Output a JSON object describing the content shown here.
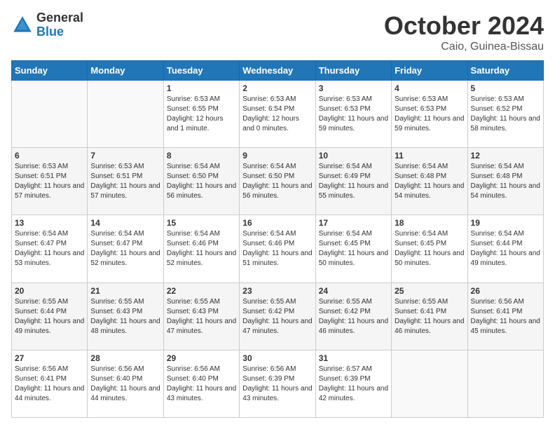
{
  "logo": {
    "general": "General",
    "blue": "Blue"
  },
  "title": {
    "month": "October 2024",
    "location": "Caio, Guinea-Bissau"
  },
  "weekdays": [
    "Sunday",
    "Monday",
    "Tuesday",
    "Wednesday",
    "Thursday",
    "Friday",
    "Saturday"
  ],
  "weeks": [
    [
      {
        "day": null
      },
      {
        "day": null
      },
      {
        "day": "1",
        "sunrise": "6:53 AM",
        "sunset": "6:55 PM",
        "daylight": "12 hours and 1 minute."
      },
      {
        "day": "2",
        "sunrise": "6:53 AM",
        "sunset": "6:54 PM",
        "daylight": "12 hours and 0 minutes."
      },
      {
        "day": "3",
        "sunrise": "6:53 AM",
        "sunset": "6:53 PM",
        "daylight": "11 hours and 59 minutes."
      },
      {
        "day": "4",
        "sunrise": "6:53 AM",
        "sunset": "6:53 PM",
        "daylight": "11 hours and 59 minutes."
      },
      {
        "day": "5",
        "sunrise": "6:53 AM",
        "sunset": "6:52 PM",
        "daylight": "11 hours and 58 minutes."
      }
    ],
    [
      {
        "day": "6",
        "sunrise": "6:53 AM",
        "sunset": "6:51 PM",
        "daylight": "11 hours and 57 minutes."
      },
      {
        "day": "7",
        "sunrise": "6:53 AM",
        "sunset": "6:51 PM",
        "daylight": "11 hours and 57 minutes."
      },
      {
        "day": "8",
        "sunrise": "6:54 AM",
        "sunset": "6:50 PM",
        "daylight": "11 hours and 56 minutes."
      },
      {
        "day": "9",
        "sunrise": "6:54 AM",
        "sunset": "6:50 PM",
        "daylight": "11 hours and 56 minutes."
      },
      {
        "day": "10",
        "sunrise": "6:54 AM",
        "sunset": "6:49 PM",
        "daylight": "11 hours and 55 minutes."
      },
      {
        "day": "11",
        "sunrise": "6:54 AM",
        "sunset": "6:48 PM",
        "daylight": "11 hours and 54 minutes."
      },
      {
        "day": "12",
        "sunrise": "6:54 AM",
        "sunset": "6:48 PM",
        "daylight": "11 hours and 54 minutes."
      }
    ],
    [
      {
        "day": "13",
        "sunrise": "6:54 AM",
        "sunset": "6:47 PM",
        "daylight": "11 hours and 53 minutes."
      },
      {
        "day": "14",
        "sunrise": "6:54 AM",
        "sunset": "6:47 PM",
        "daylight": "11 hours and 52 minutes."
      },
      {
        "day": "15",
        "sunrise": "6:54 AM",
        "sunset": "6:46 PM",
        "daylight": "11 hours and 52 minutes."
      },
      {
        "day": "16",
        "sunrise": "6:54 AM",
        "sunset": "6:46 PM",
        "daylight": "11 hours and 51 minutes."
      },
      {
        "day": "17",
        "sunrise": "6:54 AM",
        "sunset": "6:45 PM",
        "daylight": "11 hours and 50 minutes."
      },
      {
        "day": "18",
        "sunrise": "6:54 AM",
        "sunset": "6:45 PM",
        "daylight": "11 hours and 50 minutes."
      },
      {
        "day": "19",
        "sunrise": "6:54 AM",
        "sunset": "6:44 PM",
        "daylight": "11 hours and 49 minutes."
      }
    ],
    [
      {
        "day": "20",
        "sunrise": "6:55 AM",
        "sunset": "6:44 PM",
        "daylight": "11 hours and 49 minutes."
      },
      {
        "day": "21",
        "sunrise": "6:55 AM",
        "sunset": "6:43 PM",
        "daylight": "11 hours and 48 minutes."
      },
      {
        "day": "22",
        "sunrise": "6:55 AM",
        "sunset": "6:43 PM",
        "daylight": "11 hours and 47 minutes."
      },
      {
        "day": "23",
        "sunrise": "6:55 AM",
        "sunset": "6:42 PM",
        "daylight": "11 hours and 47 minutes."
      },
      {
        "day": "24",
        "sunrise": "6:55 AM",
        "sunset": "6:42 PM",
        "daylight": "11 hours and 46 minutes."
      },
      {
        "day": "25",
        "sunrise": "6:55 AM",
        "sunset": "6:41 PM",
        "daylight": "11 hours and 46 minutes."
      },
      {
        "day": "26",
        "sunrise": "6:56 AM",
        "sunset": "6:41 PM",
        "daylight": "11 hours and 45 minutes."
      }
    ],
    [
      {
        "day": "27",
        "sunrise": "6:56 AM",
        "sunset": "6:41 PM",
        "daylight": "11 hours and 44 minutes."
      },
      {
        "day": "28",
        "sunrise": "6:56 AM",
        "sunset": "6:40 PM",
        "daylight": "11 hours and 44 minutes."
      },
      {
        "day": "29",
        "sunrise": "6:56 AM",
        "sunset": "6:40 PM",
        "daylight": "11 hours and 43 minutes."
      },
      {
        "day": "30",
        "sunrise": "6:56 AM",
        "sunset": "6:39 PM",
        "daylight": "11 hours and 43 minutes."
      },
      {
        "day": "31",
        "sunrise": "6:57 AM",
        "sunset": "6:39 PM",
        "daylight": "11 hours and 42 minutes."
      },
      {
        "day": null
      },
      {
        "day": null
      }
    ]
  ]
}
